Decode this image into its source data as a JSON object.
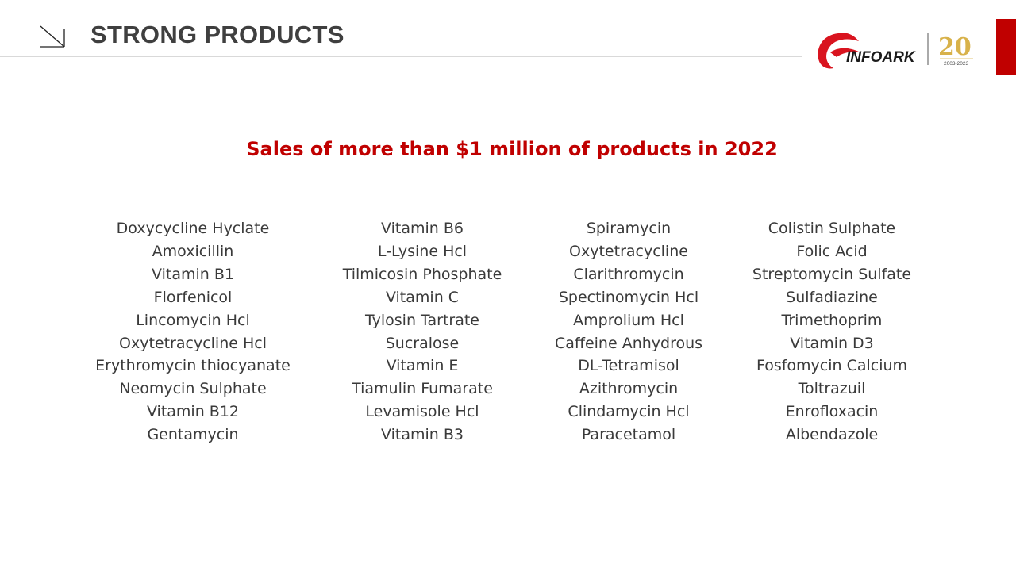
{
  "header": {
    "title": "STRONG PRODUCTS",
    "brand": {
      "name": "INFOARK",
      "anniversary_number": "20",
      "anniversary_years": "2003-2023",
      "logo_icon": "infoark-swoosh-icon",
      "anniversary_icon": "20th-anniversary-badge-icon"
    }
  },
  "main": {
    "subtitle": "Sales of more than $1 million of products in 2022",
    "columns": [
      {
        "items": [
          "Doxycycline Hyclate",
          "Amoxicillin",
          "Vitamin B1",
          "Florfenicol",
          "Lincomycin Hcl",
          "Oxytetracycline Hcl",
          "Erythromycin thiocyanate",
          "Neomycin Sulphate",
          "Vitamin B12",
          "Gentamycin"
        ]
      },
      {
        "items": [
          "Vitamin B6",
          "L-Lysine Hcl",
          "Tilmicosin Phosphate",
          "Vitamin C",
          "Tylosin Tartrate",
          "Sucralose",
          "Vitamin E",
          "Tiamulin Fumarate",
          "Levamisole Hcl",
          "Vitamin B3"
        ]
      },
      {
        "items": [
          "Spiramycin",
          "Oxytetracycline",
          "Clarithromycin",
          "Spectinomycin Hcl",
          "Amprolium Hcl",
          "Caffeine Anhydrous",
          "DL-Tetramisol",
          "Azithromycin",
          "Clindamycin Hcl",
          "Paracetamol"
        ]
      },
      {
        "items": [
          "Colistin Sulphate",
          "Folic Acid",
          "Streptomycin Sulfate",
          "Sulfadiazine",
          "Trimethoprim",
          "Vitamin D3",
          "Fosfomycin Calcium",
          "Toltrazuil",
          "Enrofloxacin",
          "Albendazole"
        ]
      }
    ]
  },
  "colors": {
    "accent_red": "#c00000",
    "title_gray": "#3f3f3f",
    "text_gray": "#3a3a3a",
    "gold": "#d8b24a"
  }
}
